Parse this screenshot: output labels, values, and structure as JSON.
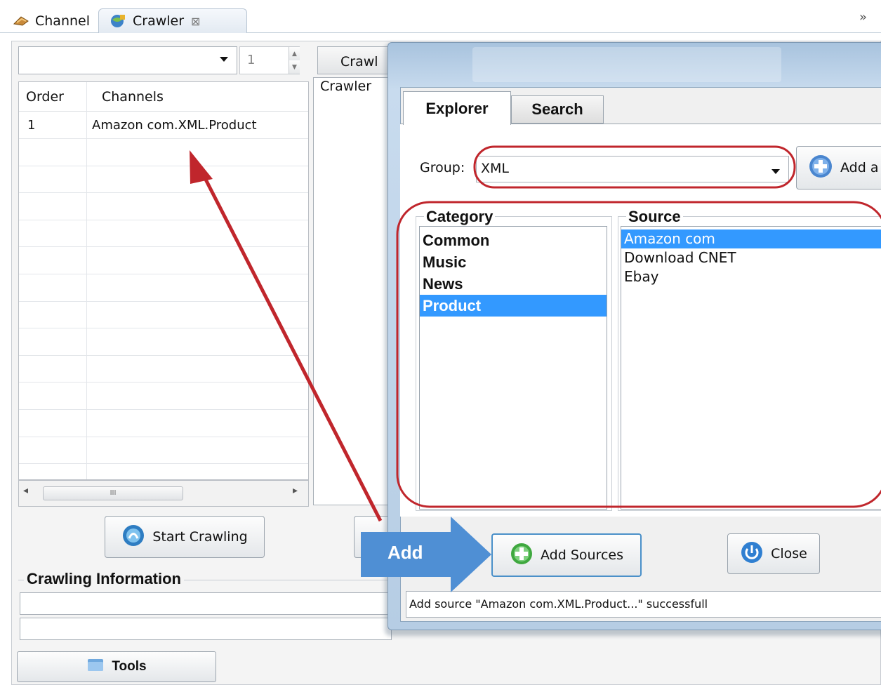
{
  "tabs": [
    {
      "label": "Channel",
      "icon": "channel-icon"
    },
    {
      "label": "Crawler",
      "icon": "crawler-icon",
      "close_icon": "close-icon"
    }
  ],
  "toolbar": {
    "overflow_icon": "chevrons-icon"
  },
  "left": {
    "spinner_value": "1",
    "table": {
      "headers": [
        "Order",
        "Channels"
      ],
      "rows": [
        {
          "order": "1",
          "channel": "Amazon com.XML.Product"
        }
      ]
    },
    "start_button": "Start Crawling",
    "info_title": "Crawling Information",
    "tools_button": "Tools"
  },
  "middle": {
    "tab_label": "Crawl",
    "inner_label": "Crawler"
  },
  "dialog": {
    "tabs": [
      "Explorer",
      "Search"
    ],
    "group_label": "Group:",
    "group_value": "XML",
    "add_button_partial": "Add a",
    "category_legend": "Category",
    "categories": [
      "Common",
      "Music",
      "News",
      "Product"
    ],
    "selected_category": "Product",
    "source_legend": "Source",
    "sources": [
      "Amazon com",
      "Download CNET",
      "Ebay"
    ],
    "selected_source": "Amazon com",
    "add_sources_button": "Add Sources",
    "close_button": "Close",
    "status_text": "Add source \"Amazon com.XML.Product...\" successfull"
  },
  "annotation": {
    "arrow_label": "Add",
    "highlight_color": "#c0262c",
    "arrow_color": "#c0262c",
    "callout_color": "#4f8fd4"
  }
}
